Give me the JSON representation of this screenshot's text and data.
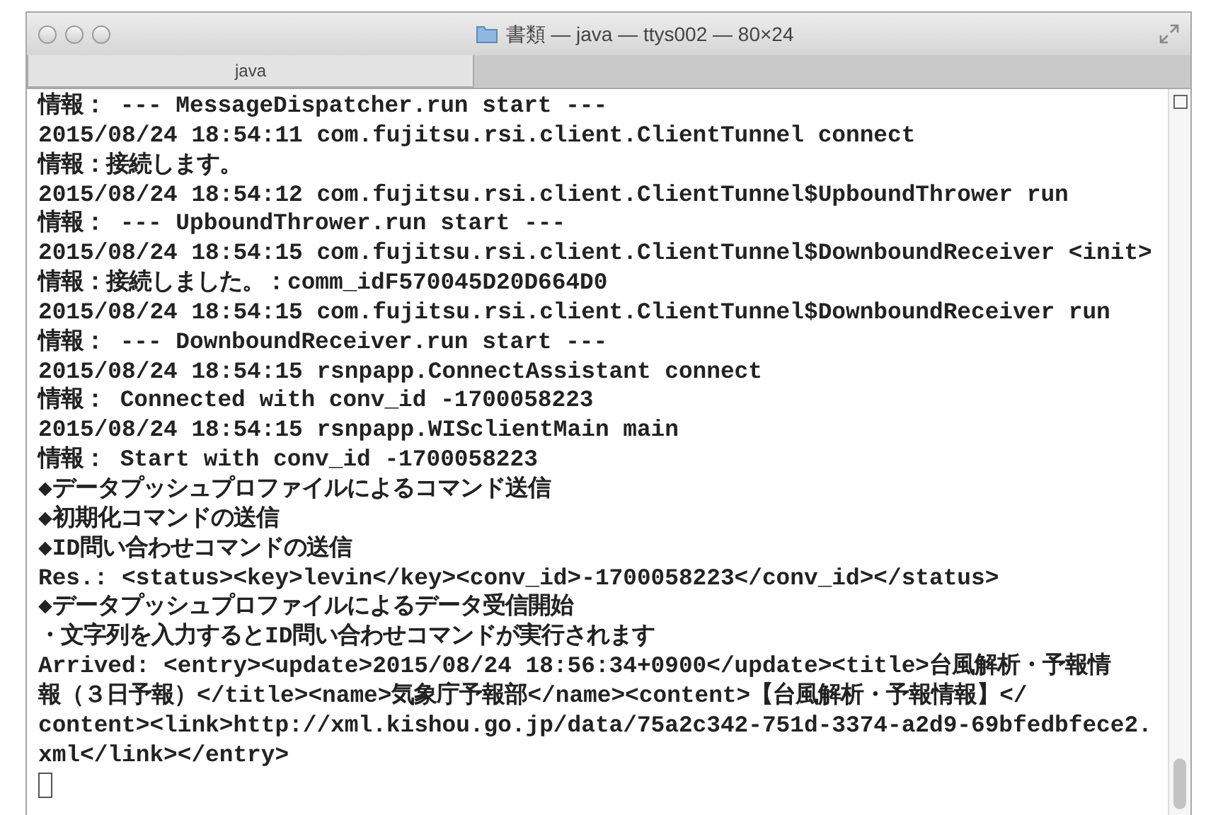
{
  "window": {
    "title": "書類 — java — ttys002 — 80×24"
  },
  "tabs": [
    {
      "label": "java",
      "selected": true
    }
  ],
  "terminal": {
    "lines": [
      "情報： --- MessageDispatcher.run start ---",
      "2015/08/24 18:54:11 com.fujitsu.rsi.client.ClientTunnel connect",
      "情報：接続します。",
      "2015/08/24 18:54:12 com.fujitsu.rsi.client.ClientTunnel$UpboundThrower run",
      "情報： --- UpboundThrower.run start ---",
      "2015/08/24 18:54:15 com.fujitsu.rsi.client.ClientTunnel$DownboundReceiver <init>",
      "情報：接続しました。：comm_idF570045D20D664D0",
      "2015/08/24 18:54:15 com.fujitsu.rsi.client.ClientTunnel$DownboundReceiver run",
      "情報： --- DownboundReceiver.run start ---",
      "2015/08/24 18:54:15 rsnpapp.ConnectAssistant connect",
      "情報： Connected with conv_id -1700058223",
      "2015/08/24 18:54:15 rsnpapp.WISclientMain main",
      "情報： Start with conv_id -1700058223",
      "◆データプッシュプロファイルによるコマンド送信",
      "◆初期化コマンドの送信",
      "◆ID問い合わせコマンドの送信",
      "Res.: <status><key>levin</key><conv_id>-1700058223</conv_id></status>",
      "◆データプッシュプロファイルによるデータ受信開始",
      "・文字列を入力するとID問い合わせコマンドが実行されます",
      "Arrived: <entry><update>2015/08/24 18:56:34+0900</update><title>台風解析・予報情",
      "報（３日予報）</title><name>気象庁予報部</name><content>【台風解析・予報情報】</",
      "content><link>http://xml.kishou.go.jp/data/75a2c342-751d-3374-a2d9-69bfedbfece2.",
      "xml</link></entry>"
    ]
  }
}
